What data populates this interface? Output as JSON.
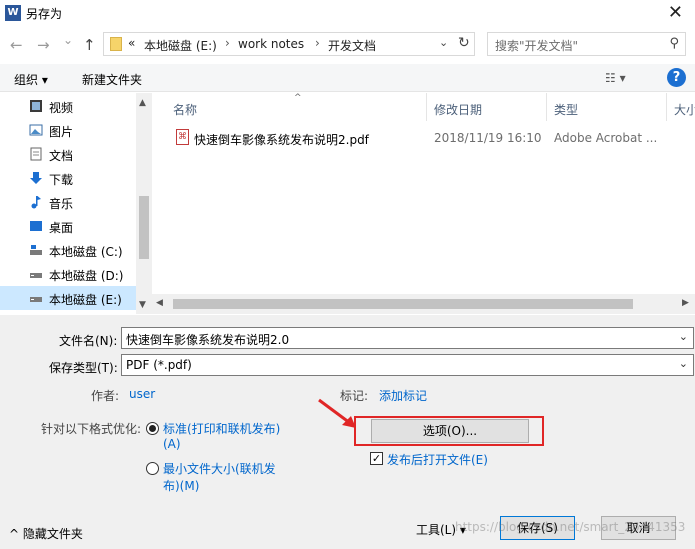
{
  "window": {
    "title": "另存为",
    "app_icon_letter": "W",
    "close_glyph": "✕"
  },
  "nav": {
    "back": "←",
    "forward": "→",
    "recent": "⌄",
    "up": "↑"
  },
  "address": {
    "overflow": "«",
    "crumbs": [
      "本地磁盘 (E:)",
      "work notes",
      "开发文档"
    ],
    "separator": "›",
    "dropdown": "⌄",
    "refresh": "↻"
  },
  "search": {
    "placeholder": "搜索\"开发文档\"",
    "icon": "⚲"
  },
  "toolbar": {
    "organize": "组织 ▾",
    "new_folder": "新建文件夹",
    "view": "☷ ▾",
    "help": "?"
  },
  "sidebar": {
    "items": [
      {
        "label": "视频",
        "icon": "video-icon"
      },
      {
        "label": "图片",
        "icon": "picture-icon"
      },
      {
        "label": "文档",
        "icon": "document-icon"
      },
      {
        "label": "下载",
        "icon": "download-icon"
      },
      {
        "label": "音乐",
        "icon": "music-icon"
      },
      {
        "label": "桌面",
        "icon": "desktop-icon"
      },
      {
        "label": "本地磁盘 (C:)",
        "icon": "drive-c-icon"
      },
      {
        "label": "本地磁盘 (D:)",
        "icon": "drive-icon"
      },
      {
        "label": "本地磁盘 (E:)",
        "icon": "drive-icon",
        "selected": true
      }
    ],
    "scroll_up": "▲",
    "scroll_down": "▼"
  },
  "file_list": {
    "columns": [
      "名称",
      "修改日期",
      "类型",
      "大小"
    ],
    "sort_arrow": "^",
    "rows": [
      {
        "name": "快速倒车影像系统发布说明2.pdf",
        "modified": "2018/11/19 16:10",
        "type": "Adobe Acrobat ..."
      }
    ],
    "hscroll_left": "◀",
    "hscroll_right": "▶"
  },
  "form": {
    "filename_label": "文件名(N):",
    "filename_value": "快速倒车影像系统发布说明2.0",
    "filetype_label": "保存类型(T):",
    "filetype_value": "PDF (*.pdf)",
    "dropdown": "⌄",
    "author_label": "作者:",
    "author_value": "user",
    "tags_label": "标记:",
    "tags_value": "添加标记",
    "optimize_label": "针对以下格式优化:",
    "option1_line1": "标准(打印和联机发布)",
    "option1_line2": "(A)",
    "option2_line1": "最小文件大小(联机发",
    "option2_line2": "布)(M)",
    "options_button": "选项(O)...",
    "open_after_label": "发布后打开文件(E)",
    "open_after_check": "✓"
  },
  "footer": {
    "hide_folders": "^ 隐藏文件夹",
    "tools": "工具(L)  ▾",
    "save": "保存(S)",
    "cancel": "取消"
  },
  "watermark": "https://blog.csdn.net/smart_26441353"
}
